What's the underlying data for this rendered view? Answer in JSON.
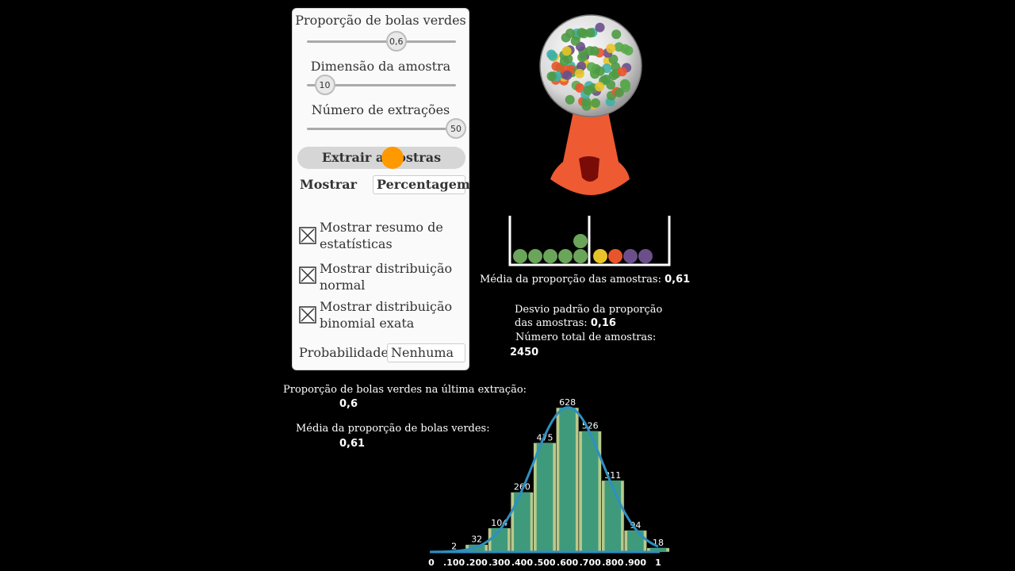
{
  "controls": {
    "proportion_label": "Proporção de bolas verdes",
    "proportion_value": "0,6",
    "proportion_fraction": 0.6,
    "sample_size_label": "Dimensão da amostra",
    "sample_size_value": "10",
    "sample_size_fraction": 0.12,
    "draws_label": "Número de extrações",
    "draws_value": "50",
    "draws_fraction": 1.0,
    "draw_button": "Extrair amostras",
    "show_label": "Mostrar",
    "show_select": "Percentagem",
    "checkboxes": [
      {
        "label": "Mostrar resumo de estatísticas",
        "checked": true
      },
      {
        "label": "Mostrar distribuição normal",
        "checked": true
      },
      {
        "label": "Mostrar distribuição binomial exata",
        "checked": true
      }
    ],
    "probability_label": "Probabilidade",
    "probability_select": "Nenhuma"
  },
  "stats": {
    "mean_label": "Média da proporção das amostras:",
    "mean_value": "0,61",
    "sd_label": "Desvio padrão da proporção das amostras:",
    "sd_value": "0,16",
    "total_label": "Número total de amostras:",
    "total_value": "2450",
    "last_label": "Proporção de bolas verdes na última extração:",
    "last_value": "0,6",
    "avg_green_label": "Média da proporção de bolas verdes:",
    "avg_green_value": "0,61"
  },
  "tray": {
    "balls": [
      "#6aa55a",
      "#6aa55a",
      "#6aa55a",
      "#6aa55a",
      "#6aa55a",
      "#6aa55a",
      "#e8c42a",
      "#e8552a",
      "#6b4f8a",
      "#6b4f8a"
    ]
  },
  "colors": {
    "bar_light": "#b8c98a",
    "bar_dark": "#3f9a7c",
    "curve": "#2e8fc0",
    "machine": "#ee5a32"
  },
  "chart_data": {
    "type": "bar",
    "categories": [
      "0",
      ".100",
      ".200",
      ".300",
      ".400",
      ".500",
      ".600",
      ".700",
      ".800",
      ".900",
      "1"
    ],
    "values": [
      0,
      2,
      32,
      104,
      260,
      475,
      628,
      526,
      311,
      94,
      18
    ],
    "value_labels": [
      "",
      "2",
      "32",
      "104",
      "260",
      "475",
      "628",
      "526",
      "311",
      "94",
      "18"
    ],
    "overlay": "normal curve"
  }
}
